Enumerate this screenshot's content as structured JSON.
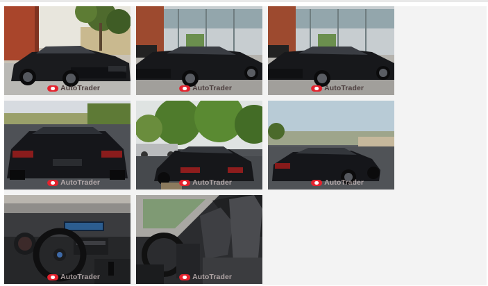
{
  "gallery": {
    "watermark": "AutoTrader",
    "photos": [
      {
        "name": "photo-front-driveway",
        "scene": "front-driveway",
        "watermark_style": "light"
      },
      {
        "name": "photo-front-building",
        "scene": "front-building",
        "watermark_style": "light"
      },
      {
        "name": "photo-front-building-2",
        "scene": "front-building",
        "watermark_style": "light"
      },
      {
        "name": "photo-rear-view",
        "scene": "rear",
        "watermark_style": "dark"
      },
      {
        "name": "photo-rear-three-quarter",
        "scene": "rear-trees",
        "watermark_style": "dark"
      },
      {
        "name": "photo-rear-hillside",
        "scene": "rear-side",
        "watermark_style": "dark"
      },
      {
        "name": "photo-dashboard",
        "scene": "dashboard",
        "watermark_style": "dark"
      },
      {
        "name": "photo-front-seats",
        "scene": "seats",
        "watermark_style": "dark"
      }
    ]
  }
}
